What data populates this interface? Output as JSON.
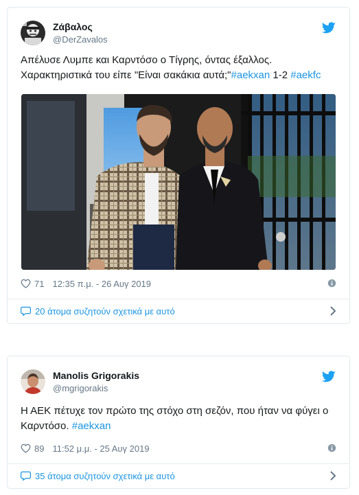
{
  "tweets": [
    {
      "name": "Ζάβαλος",
      "handle": "@DerZavalos",
      "text_line1": "Απέλυσε Λυμπε και Καρντόσο ο Τίγρης, όντας έξαλλος.",
      "text_line2_plain": "Χαρακτηριστικά του είπε \"Είναι σακάκια αυτά;\"",
      "hashtag1": "#aekxan",
      "score": " 1-2 ",
      "hashtag2": "#aekfc",
      "likes": "71",
      "timestamp": "12:35 π.μ. - 26 Αυγ 2019",
      "conversation": "20 άτομα συζητούν σχετικά με αυτό"
    },
    {
      "name": "Manolis Grigorakis",
      "handle": "@mgrigorakis",
      "text_line1": "Η ΑΕΚ πέτυχε τον πρώτο της στόχο στη σεζόν, που ήταν να φύγει ο",
      "text_line2_plain": "Καρντόσο. ",
      "hashtag1": "#aekxan",
      "likes": "89",
      "timestamp": "11:52 μ.μ. - 25 Αυγ 2019",
      "conversation": "35 άτομα συζητούν σχετικά με αυτό"
    }
  ],
  "colors": {
    "twitter_blue": "#1da1f2",
    "link_blue": "#1b95e0",
    "muted_gray": "#657786",
    "border": "#e1e8ed"
  },
  "icons": [
    "twitter-bird-icon",
    "heart-icon",
    "info-icon",
    "reply-bubble-icon",
    "chevron-right-icon"
  ]
}
